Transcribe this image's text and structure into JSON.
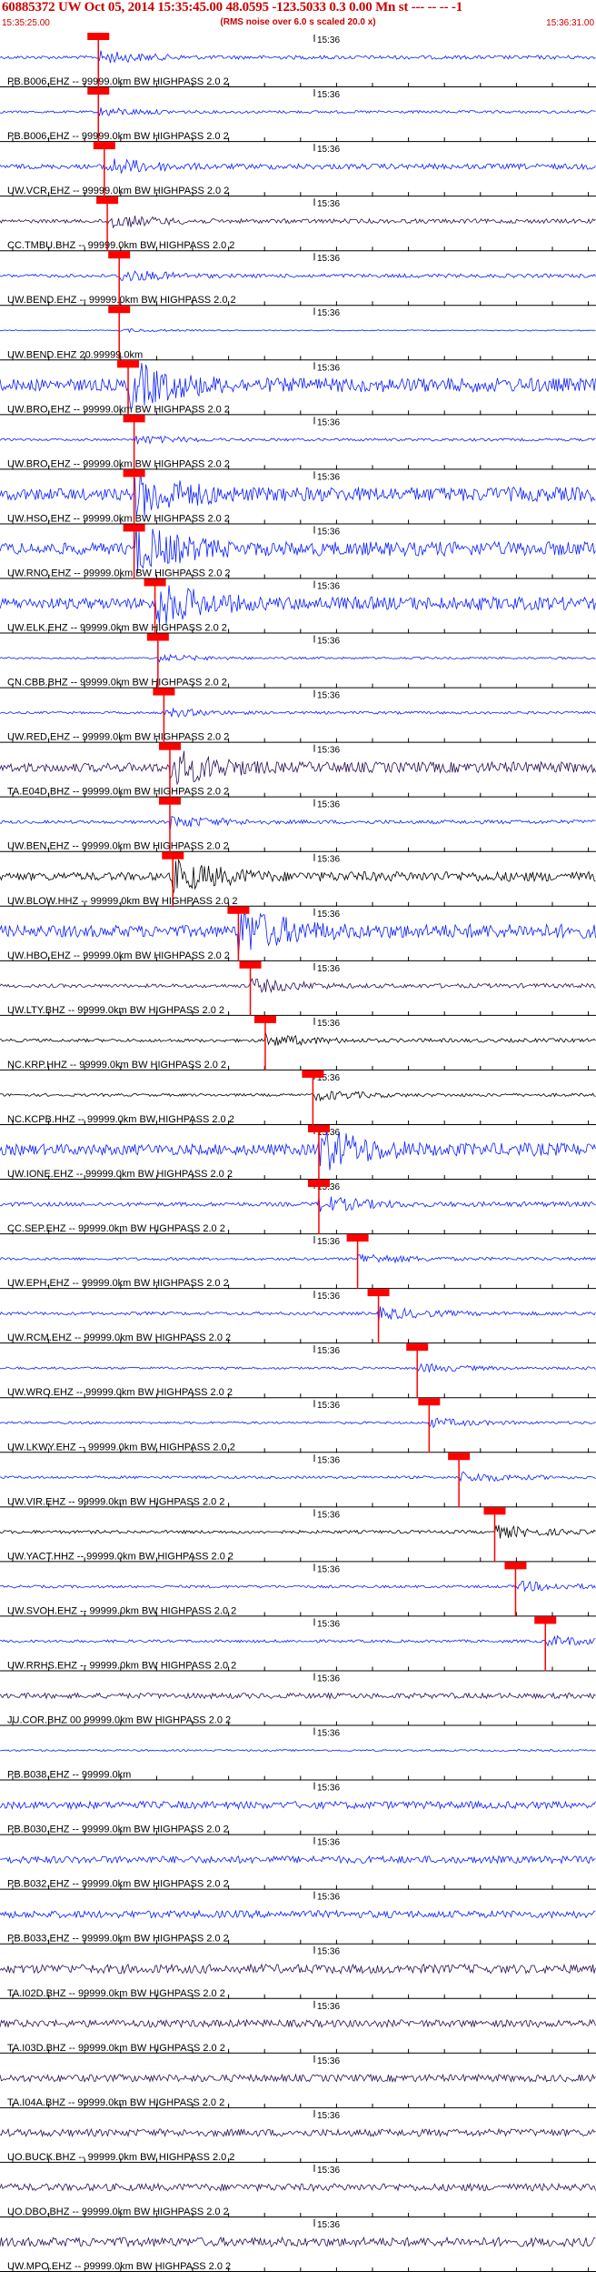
{
  "header": {
    "title": "60885372 UW Oct 05, 2014 15:35:45.00   48.0595 -123.5033  0.3 0.00 Mn st --- -- -- -1",
    "subtitle": "(RMS noise over 6.0 s scaled 20.0 x)",
    "start_time": "15:35:25.00",
    "end_time": "15:36:31.00"
  },
  "time_mark_label": "15:36",
  "colors": {
    "blue": "#0a1eff",
    "dark": "#2b0f55",
    "black": "#000000",
    "pick": "#ff0000"
  },
  "traces": [
    {
      "label": "PB.B006.EHZ -- 99999.0km BW  HIGHPASS  2.0  2",
      "color": "blue",
      "amp": 7,
      "pick": 0.165
    },
    {
      "label": "PB.B006.EHZ -- 99999.0km BW  HIGHPASS  2.0  2",
      "color": "blue",
      "amp": 5,
      "pick": 0.165
    },
    {
      "label": "UW.VCR.EHZ -- 99999.0km BW  HIGHPASS  2.0  2",
      "color": "blue",
      "amp": 10,
      "pick": 0.175
    },
    {
      "label": "CC.TMBU.BHZ -- 99999.0km BW  HIGHPASS  2.0  2",
      "color": "dark",
      "amp": 8,
      "pick": 0.18
    },
    {
      "label": "UW.BEND.EHZ -- 99999.0km BW  HIGHPASS  2.0  2",
      "color": "blue",
      "amp": 7,
      "pick": 0.2
    },
    {
      "label": "UW.BEND.EHZ 20.99999.0km",
      "color": "blue",
      "amp": 2,
      "pick": 0.2
    },
    {
      "label": "UW.BRO.EHZ -- 99999.0km BW  HIGHPASS  2.0  2",
      "color": "blue",
      "amp": 26,
      "pick": 0.215
    },
    {
      "label": "UW.BRO.EHZ -- 99999.0km BW  HIGHPASS  2.0  2",
      "color": "blue",
      "amp": 5,
      "pick": 0.225
    },
    {
      "label": "UW.HSO.EHZ -- 99999.0km BW  HIGHPASS  2.0  2",
      "color": "blue",
      "amp": 26,
      "pick": 0.225
    },
    {
      "label": "UW.RNO.EHZ -- 99999.0km BW  HIGHPASS  2.0  2",
      "color": "blue",
      "amp": 26,
      "pick": 0.225
    },
    {
      "label": "UW.ELK.EHZ -- 99999.0km BW  HIGHPASS  2.0  2",
      "color": "blue",
      "amp": 24,
      "pick": 0.26
    },
    {
      "label": "CN.CBB.BHZ -- 99999.0km BW  HIGHPASS  2.0  2",
      "color": "blue",
      "amp": 4,
      "pick": 0.265
    },
    {
      "label": "UW.RED.EHZ -- 99999.0km BW  HIGHPASS  2.0  2",
      "color": "blue",
      "amp": 5,
      "pick": 0.275
    },
    {
      "label": "TA.E04D.BHZ -- 99999.0km BW  HIGHPASS  2.0  2",
      "color": "dark",
      "amp": 20,
      "pick": 0.285
    },
    {
      "label": "UW.BEN.EHZ -- 99999.0km BW  HIGHPASS  2.0  2",
      "color": "blue",
      "amp": 7,
      "pick": 0.285
    },
    {
      "label": "UW.BLOW.HHZ -- 99999.0km BW  HIGHPASS  2.0  2",
      "color": "black",
      "amp": 18,
      "pick": 0.29
    },
    {
      "label": "UW.HBO.EHZ -- 99999.0km BW  HIGHPASS  2.0  2",
      "color": "blue",
      "amp": 26,
      "pick": 0.4
    },
    {
      "label": "UW.LTY.BHZ -- 99999.0km BW  HIGHPASS  2.0  2",
      "color": "dark",
      "amp": 8,
      "pick": 0.42
    },
    {
      "label": "NC.KRP.HHZ -- 99999.0km BW  HIGHPASS  2.0  2",
      "color": "black",
      "amp": 7,
      "pick": 0.445
    },
    {
      "label": "NC.KCPB.HHZ -- 99999.0km BW  HIGHPASS  2.0  2",
      "color": "black",
      "amp": 6,
      "pick": 0.525
    },
    {
      "label": "UW.IONE.EHZ -- 99999.0km BW  HIGHPASS  2.0  2",
      "color": "blue",
      "amp": 24,
      "pick": 0.535
    },
    {
      "label": "CC.SEP.EHZ -- 99999.0km BW  HIGHPASS  2.0  2",
      "color": "blue",
      "amp": 9,
      "pick": 0.535
    },
    {
      "label": "UW.EPH.EHZ -- 99999.0km BW  HIGHPASS  2.0  2",
      "color": "blue",
      "amp": 6,
      "pick": 0.6
    },
    {
      "label": "UW.RCM.EHZ -- 99999.0km BW  HIGHPASS  2.0  2",
      "color": "blue",
      "amp": 7,
      "pick": 0.635
    },
    {
      "label": "UW.WRO.EHZ -- 99999.0km BW  HIGHPASS  2.0  2",
      "color": "blue",
      "amp": 5,
      "pick": 0.7
    },
    {
      "label": "UW.LKWY.EHZ -- 99999.0km BW  HIGHPASS  2.0  2",
      "color": "blue",
      "amp": 5,
      "pick": 0.72
    },
    {
      "label": "UW.VIR.EHZ -- 99999.0km BW  HIGHPASS  2.0  2",
      "color": "blue",
      "amp": 6,
      "pick": 0.77
    },
    {
      "label": "UW.YACT.HHZ -- 99999.0km BW  HIGHPASS  2.0  2",
      "color": "black",
      "amp": 7,
      "pick": 0.83
    },
    {
      "label": "UW.SVOH.EHZ -- 99999.0km BW  HIGHPASS  2.0  2",
      "color": "blue",
      "amp": 6,
      "pick": 0.865
    },
    {
      "label": "UW.RRHS.EHZ -- 99999.0km BW  HIGHPASS  2.0  2",
      "color": "blue",
      "amp": 6,
      "pick": 0.915
    },
    {
      "label": "JU.COR.BHZ 00 99999.0km BW  HIGHPASS  2.0  2",
      "color": "dark",
      "amp": 3,
      "pick": null
    },
    {
      "label": "PB.B038.EHZ -- 99999.0km",
      "color": "blue",
      "amp": 1,
      "pick": null
    },
    {
      "label": "PB.B030.EHZ -- 99999.0km BW  HIGHPASS  2.0  2",
      "color": "blue",
      "amp": 4,
      "pick": null
    },
    {
      "label": "PB.B032.EHZ -- 99999.0km BW  HIGHPASS  2.0  2",
      "color": "blue",
      "amp": 4,
      "pick": null
    },
    {
      "label": "PB.B033.EHZ -- 99999.0km BW  HIGHPASS  2.0  2",
      "color": "blue",
      "amp": 4,
      "pick": null
    },
    {
      "label": "TA.I02D.BHZ -- 99999.0km BW  HIGHPASS  2.0  2",
      "color": "dark",
      "amp": 5,
      "pick": null
    },
    {
      "label": "TA.I03D.BHZ -- 99999.0km BW  HIGHPASS  2.0  2",
      "color": "dark",
      "amp": 4,
      "pick": null
    },
    {
      "label": "TA.I04A.BHZ -- 99999.0km BW  HIGHPASS  2.0  2",
      "color": "dark",
      "amp": 4,
      "pick": null
    },
    {
      "label": "UO.BUCK.BHZ -- 99999.0km BW  HIGHPASS  2.0  2",
      "color": "dark",
      "amp": 4,
      "pick": null
    },
    {
      "label": "UO.DBO.BHZ -- 99999.0km BW  HIGHPASS  2.0  2",
      "color": "dark",
      "amp": 4,
      "pick": null
    },
    {
      "label": "UW.MPO.EHZ -- 99999.0km BW  HIGHPASS  2.0  2",
      "color": "dark",
      "amp": 5,
      "pick": null
    }
  ]
}
